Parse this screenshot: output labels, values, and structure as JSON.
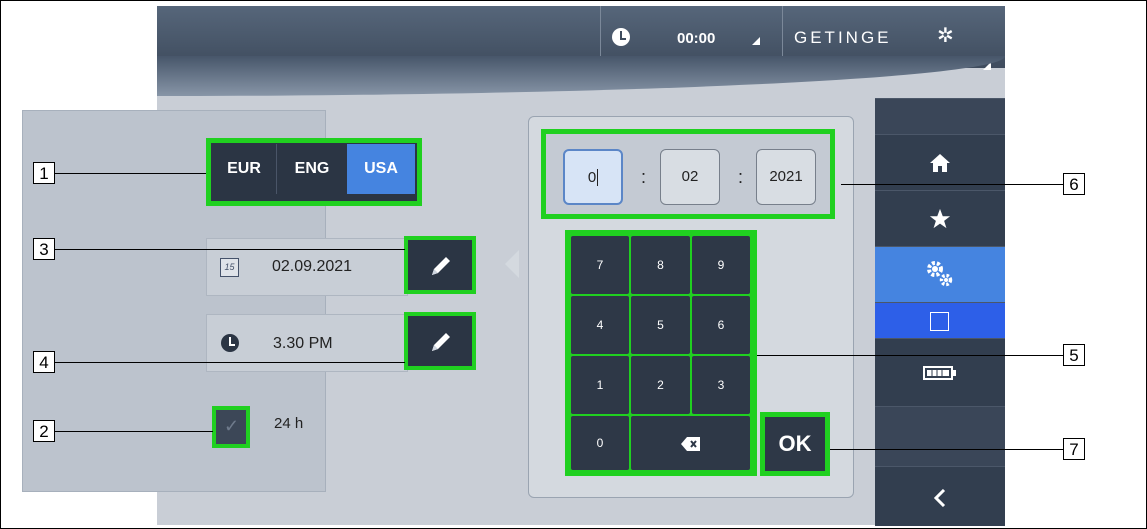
{
  "topbar": {
    "time": "00:00",
    "brand": "GETINGE",
    "brand_mark": "✲"
  },
  "region": {
    "options": [
      "EUR",
      "ENG",
      "USA"
    ],
    "selected": "USA"
  },
  "date": {
    "icon_text": "15",
    "value": "02.09.2021"
  },
  "time": {
    "value": "3.30 PM"
  },
  "format24": {
    "label": "24 h",
    "checked": true
  },
  "date_input": {
    "month": "0",
    "day": "02",
    "year": "2021",
    "separator": ":"
  },
  "keypad": {
    "keys": [
      "7",
      "8",
      "9",
      "4",
      "5",
      "6",
      "1",
      "2",
      "3",
      "0"
    ],
    "backspace_icon": "backspace-icon",
    "ok_label": "OK"
  },
  "nav": {
    "items": [
      "home-icon",
      "star-icon",
      "settings-gears-icon",
      "calendar-icon",
      "battery-icon",
      "back-chevron-icon"
    ],
    "active": "settings-gears-icon"
  },
  "callouts": [
    "1",
    "2",
    "3",
    "4",
    "5",
    "6",
    "7"
  ],
  "colors": {
    "highlight": "#20d020",
    "active_blue": "#4584e0",
    "dark_button": "#2e3847"
  }
}
